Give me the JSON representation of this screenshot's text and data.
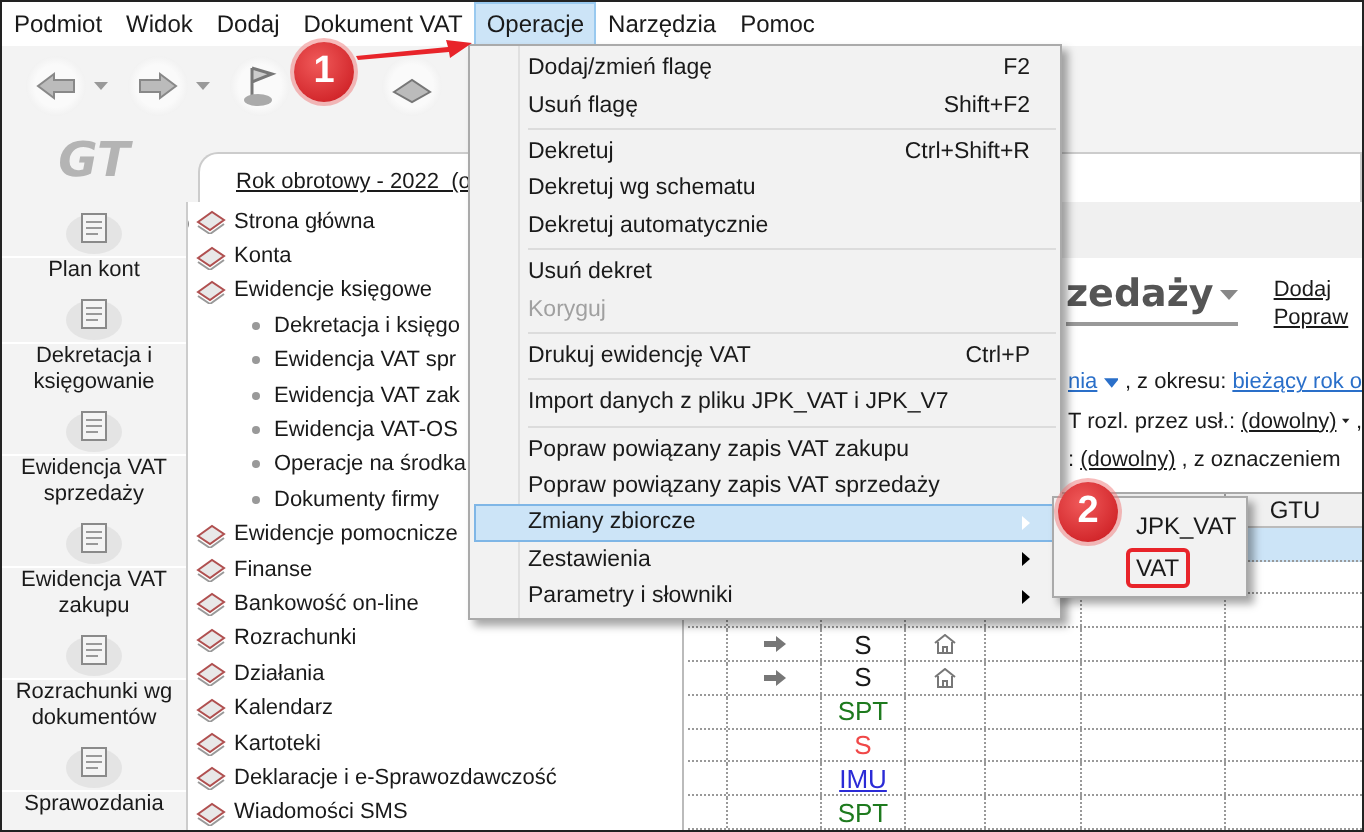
{
  "menubar": {
    "items": [
      {
        "label": "Podmiot",
        "selected": false
      },
      {
        "label": "Widok",
        "selected": false
      },
      {
        "label": "Dodaj",
        "selected": false
      },
      {
        "label": "Dokument VAT",
        "selected": false
      },
      {
        "label": "Operacje",
        "selected": true
      },
      {
        "label": "Narzędzia",
        "selected": false
      },
      {
        "label": "Pomoc",
        "selected": false
      }
    ]
  },
  "logo": {
    "text": "GT"
  },
  "shortcuts": [
    "Plan kont",
    "Dekretacja i księgowanie",
    "Ewidencja VAT sprzedaży",
    "Ewidencja VAT zakupu",
    "Rozrachunki wg dokumentów",
    "Sprawozdania"
  ],
  "document_tab": {
    "label": "Rok obrotowy - 2022  (o"
  },
  "nav_tree": {
    "items": [
      {
        "label": "Strona główna"
      },
      {
        "label": "Konta"
      },
      {
        "label": "Ewidencje księgowe",
        "children": [
          {
            "label": "Dekretacja i księgo"
          },
          {
            "label": "Ewidencja VAT spr"
          },
          {
            "label": "Ewidencja VAT zak"
          },
          {
            "label": "Ewidencja VAT-OS"
          },
          {
            "label": "Operacje na środka"
          },
          {
            "label": "Dokumenty firmy"
          }
        ]
      },
      {
        "label": "Ewidencje pomocnicze"
      },
      {
        "label": "Finanse"
      },
      {
        "label": "Bankowość on-line"
      },
      {
        "label": "Rozrachunki"
      },
      {
        "label": "Działania"
      },
      {
        "label": "Kalendarz"
      },
      {
        "label": "Kartoteki"
      },
      {
        "label": "Deklaracje i e-Sprawozdawczość"
      },
      {
        "label": "Wiadomości SMS"
      }
    ]
  },
  "register": {
    "title": "zedaży",
    "actions": [
      "Dodaj",
      "Popraw"
    ],
    "filters": [
      [
        {
          "kind": "link_dropdown",
          "text": "nia"
        },
        {
          "kind": "text",
          "text": ", z okresu:"
        },
        {
          "kind": "link",
          "text": "bieżący rok o"
        }
      ],
      [
        {
          "kind": "text",
          "text": "T rozl. przez usł.:"
        },
        {
          "kind": "select_dropdown",
          "text": "(dowolny)"
        },
        {
          "kind": "text",
          "text": ","
        }
      ],
      [
        {
          "kind": "text",
          "text": ":"
        },
        {
          "kind": "select",
          "text": "(dowolny)"
        },
        {
          "kind": "text",
          "text": ", z oznaczeniem"
        }
      ]
    ],
    "table": {
      "header": {
        "column_7": "GTU"
      },
      "rows": [
        {
          "selected": true
        },
        {
          "selected": false
        },
        {
          "selected": false
        },
        {
          "selected": false,
          "arrow": true,
          "house": true,
          "code": {
            "text": "S",
            "color": "#1a1a1a",
            "link": false
          }
        },
        {
          "selected": false,
          "arrow": true,
          "house": true,
          "code": {
            "text": "S",
            "color": "#1a1a1a",
            "link": false
          }
        },
        {
          "selected": false,
          "arrow": false,
          "house": false,
          "code": {
            "text": "SPT",
            "color": "#1e7a1e",
            "link": false
          }
        },
        {
          "selected": false,
          "arrow": false,
          "house": false,
          "code": {
            "text": "S",
            "color": "#f04848",
            "link": false
          }
        },
        {
          "selected": false,
          "arrow": false,
          "house": false,
          "code": {
            "text": "IMU",
            "color": "#2b2bd6",
            "link": true
          }
        },
        {
          "selected": false,
          "arrow": false,
          "house": false,
          "code": {
            "text": "SPT",
            "color": "#1e7a1e",
            "link": false
          }
        }
      ]
    }
  },
  "operations_menu": {
    "items": [
      {
        "kind": "item",
        "label": "Dodaj/zmień flagę",
        "shortcut": "F2",
        "disabled": false,
        "selected": false,
        "submenu": false
      },
      {
        "kind": "item",
        "label": "Usuń flagę",
        "shortcut": "Shift+F2",
        "disabled": false,
        "selected": false,
        "submenu": false
      },
      {
        "kind": "separator"
      },
      {
        "kind": "item",
        "label": "Dekretuj",
        "shortcut": "Ctrl+Shift+R",
        "disabled": false,
        "selected": false,
        "submenu": false
      },
      {
        "kind": "item",
        "label": "Dekretuj wg schematu",
        "disabled": false,
        "selected": false,
        "submenu": false
      },
      {
        "kind": "item",
        "label": "Dekretuj automatycznie",
        "disabled": false,
        "selected": false,
        "submenu": false
      },
      {
        "kind": "separator"
      },
      {
        "kind": "item",
        "label": "Usuń dekret",
        "disabled": false,
        "selected": false,
        "submenu": false
      },
      {
        "kind": "item",
        "label": "Koryguj",
        "disabled": true,
        "selected": false,
        "submenu": false
      },
      {
        "kind": "separator"
      },
      {
        "kind": "item",
        "label": "Drukuj ewidencję VAT",
        "shortcut": "Ctrl+P",
        "disabled": false,
        "selected": false,
        "submenu": false
      },
      {
        "kind": "separator"
      },
      {
        "kind": "item",
        "label": "Import danych z pliku JPK_VAT i JPK_V7",
        "disabled": false,
        "selected": false,
        "submenu": false
      },
      {
        "kind": "separator"
      },
      {
        "kind": "item",
        "label": "Popraw powiązany zapis VAT zakupu",
        "disabled": false,
        "selected": false,
        "submenu": false
      },
      {
        "kind": "item",
        "label": "Popraw powiązany zapis VAT sprzedaży",
        "disabled": false,
        "selected": false,
        "submenu": false
      },
      {
        "kind": "item",
        "label": "Zmiany zbiorcze",
        "disabled": false,
        "selected": true,
        "submenu": true
      },
      {
        "kind": "item",
        "label": "Zestawienia",
        "disabled": false,
        "selected": false,
        "submenu": true
      },
      {
        "kind": "item",
        "label": "Parametry i słowniki",
        "disabled": false,
        "selected": false,
        "submenu": true
      }
    ]
  },
  "submenu": {
    "items": [
      {
        "label": "JPK_VAT",
        "marked": false
      },
      {
        "label": "VAT",
        "marked": true
      }
    ]
  },
  "callouts": [
    {
      "number": "1"
    },
    {
      "number": "2"
    }
  ]
}
